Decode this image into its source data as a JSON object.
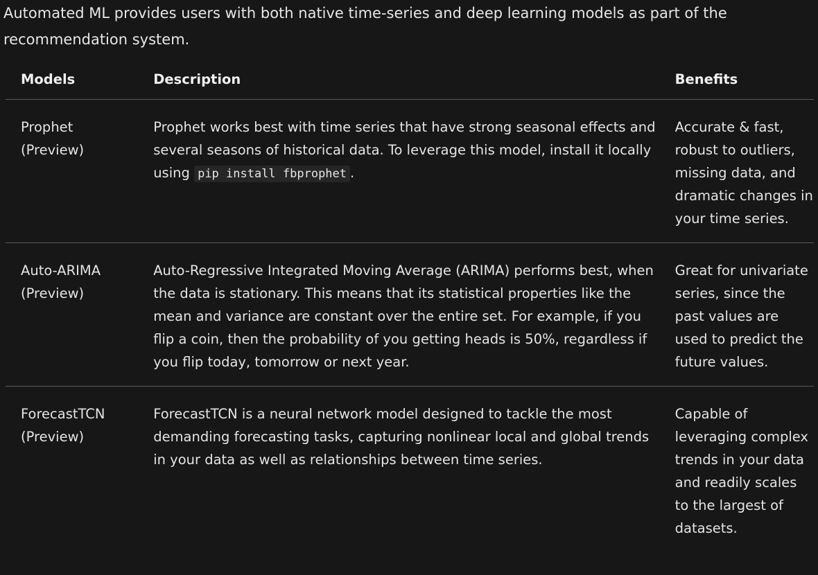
{
  "intro": "Automated ML provides users with both native time-series and deep learning models as part of the recommendation system.",
  "table": {
    "headers": {
      "models": "Models",
      "description": "Description",
      "benefits": "Benefits"
    },
    "rows": [
      {
        "model": "Prophet (Preview)",
        "description": "Prophet works best with time series that have strong seasonal effects and several seasons of historical data. To leverage this model, install it locally using",
        "code": "pip install fbprophet",
        "description_end": ".",
        "benefits": "Accurate & fast, robust to outliers, missing data, and dramatic changes in your time series."
      },
      {
        "model": "Auto-ARIMA (Preview)",
        "description": "Auto-Regressive Integrated Moving Average (ARIMA) performs best, when the data is stationary. This means that its statistical properties like the mean and variance are constant over the entire set. For example, if you flip a coin, then the probability of you getting heads is 50%, regardless if you flip today, tomorrow or next year.",
        "benefits": "Great for univariate series, since the past values are used to predict the future values."
      },
      {
        "model": "ForecastTCN (Preview)",
        "description": "ForecastTCN is a neural network model designed to tackle the most demanding forecasting tasks, capturing nonlinear local and global trends in your data as well as relationships between time series.",
        "benefits": "Capable of leveraging complex trends in your data and readily scales to the largest of datasets."
      }
    ]
  }
}
